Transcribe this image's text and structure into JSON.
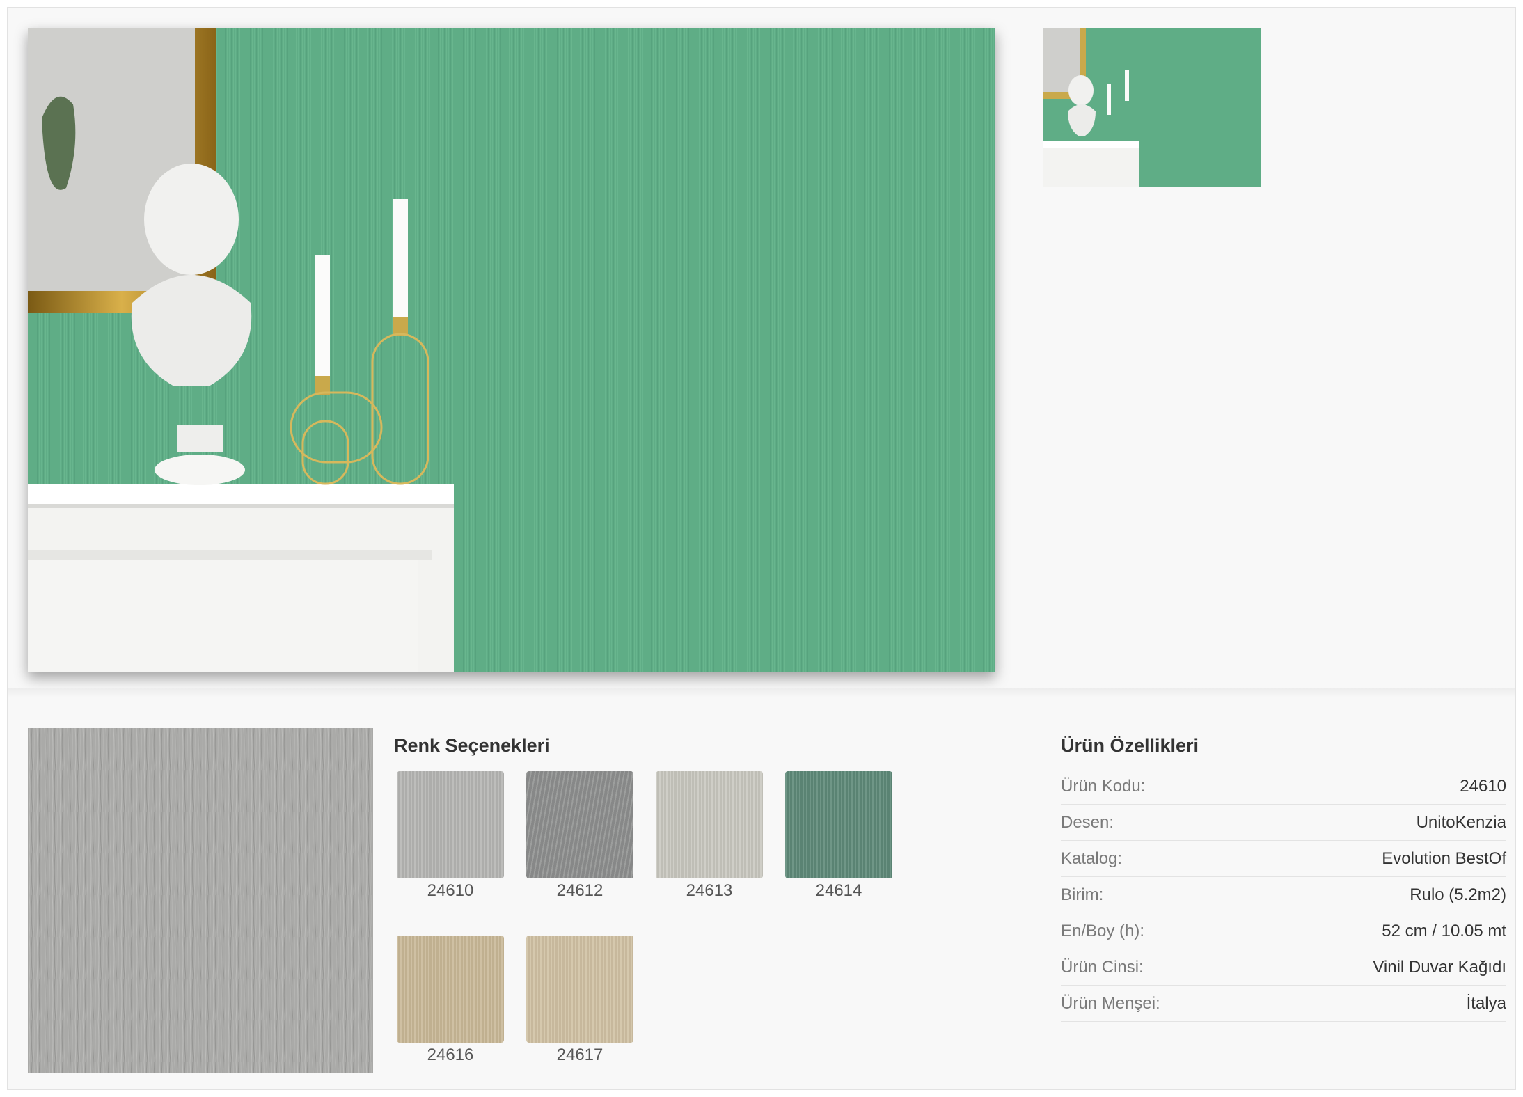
{
  "gallery": {
    "main_image_alt": "Yeşil duvar kağıdı oda görünümü",
    "thumbnail_alt": "Küçük resim"
  },
  "colors": {
    "title": "Renk Seçenekleri",
    "swatches": [
      {
        "code": "24610",
        "color": "#b4b4b2"
      },
      {
        "code": "24612",
        "color": "#8f9190"
      },
      {
        "code": "24613",
        "color": "#c7c6bd"
      },
      {
        "code": "24614",
        "color": "#5f8a79"
      },
      {
        "code": "24616",
        "color": "#c8b796"
      },
      {
        "code": "24617",
        "color": "#cfc0a2"
      }
    ]
  },
  "specs": {
    "title": "Ürün Özellikleri",
    "rows": [
      {
        "label": "Ürün Kodu:",
        "value": "24610"
      },
      {
        "label": "Desen:",
        "value": "UnitoKenzia"
      },
      {
        "label": "Katalog:",
        "value": "Evolution BestOf"
      },
      {
        "label": "Birim:",
        "value": "Rulo (5.2m2)"
      },
      {
        "label": "En/Boy (h):",
        "value": "52 cm / 10.05 mt"
      },
      {
        "label": "Ürün Cinsi:",
        "value": "Vinil Duvar Kağıdı"
      },
      {
        "label": "Ürün Menşei:",
        "value": "İtalya"
      }
    ]
  },
  "theme": {
    "wall_green": "#5fad86",
    "preview_gray": "#aaaaa8"
  }
}
